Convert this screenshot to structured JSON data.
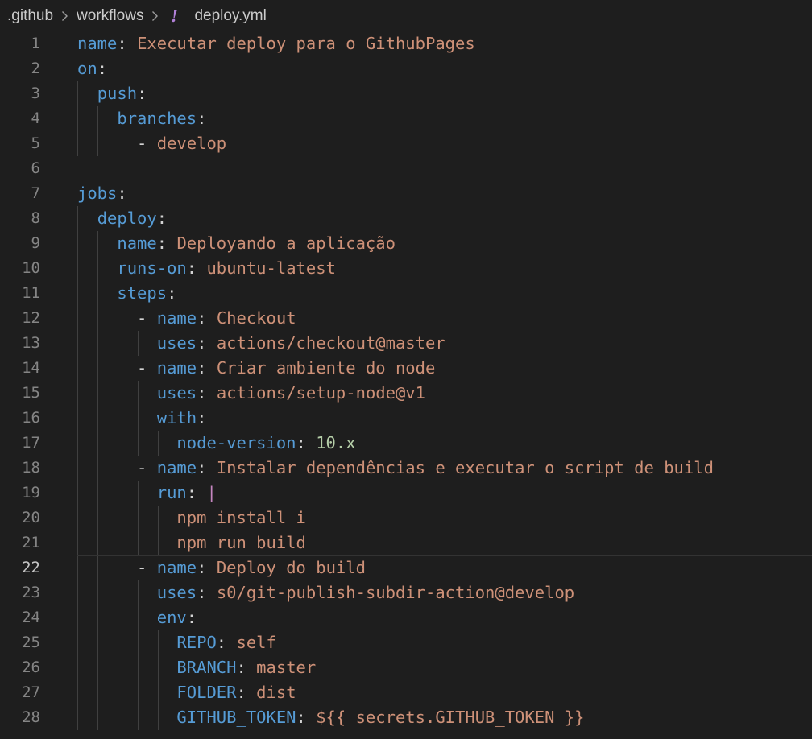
{
  "breadcrumb": {
    "folder1": ".github",
    "folder2": "workflows",
    "file_icon": "!",
    "file": "deploy.yml"
  },
  "editor": {
    "active_line": 22,
    "lines": [
      {
        "n": "1",
        "code": [
          {
            "t": "name",
            "c": "k"
          },
          {
            "t": ": ",
            "c": "p"
          },
          {
            "t": "Executar deploy para o GithubPages",
            "c": "s"
          }
        ]
      },
      {
        "n": "2",
        "code": [
          {
            "t": "on",
            "c": "k"
          },
          {
            "t": ":",
            "c": "p"
          }
        ]
      },
      {
        "n": "3",
        "code": [
          {
            "t": "  ",
            "c": "p"
          },
          {
            "t": "push",
            "c": "k"
          },
          {
            "t": ":",
            "c": "p"
          }
        ]
      },
      {
        "n": "4",
        "code": [
          {
            "t": "    ",
            "c": "p"
          },
          {
            "t": "branches",
            "c": "k"
          },
          {
            "t": ":",
            "c": "p"
          }
        ]
      },
      {
        "n": "5",
        "code": [
          {
            "t": "      - ",
            "c": "p"
          },
          {
            "t": "develop",
            "c": "s"
          }
        ]
      },
      {
        "n": "6",
        "code": []
      },
      {
        "n": "7",
        "code": [
          {
            "t": "jobs",
            "c": "k"
          },
          {
            "t": ":",
            "c": "p"
          }
        ]
      },
      {
        "n": "8",
        "code": [
          {
            "t": "  ",
            "c": "p"
          },
          {
            "t": "deploy",
            "c": "k"
          },
          {
            "t": ":",
            "c": "p"
          }
        ]
      },
      {
        "n": "9",
        "code": [
          {
            "t": "    ",
            "c": "p"
          },
          {
            "t": "name",
            "c": "k"
          },
          {
            "t": ": ",
            "c": "p"
          },
          {
            "t": "Deployando a aplicação",
            "c": "s"
          }
        ]
      },
      {
        "n": "10",
        "code": [
          {
            "t": "    ",
            "c": "p"
          },
          {
            "t": "runs-on",
            "c": "k"
          },
          {
            "t": ": ",
            "c": "p"
          },
          {
            "t": "ubuntu-latest",
            "c": "s"
          }
        ]
      },
      {
        "n": "11",
        "code": [
          {
            "t": "    ",
            "c": "p"
          },
          {
            "t": "steps",
            "c": "k"
          },
          {
            "t": ":",
            "c": "p"
          }
        ]
      },
      {
        "n": "12",
        "code": [
          {
            "t": "      - ",
            "c": "p"
          },
          {
            "t": "name",
            "c": "k"
          },
          {
            "t": ": ",
            "c": "p"
          },
          {
            "t": "Checkout",
            "c": "s"
          }
        ]
      },
      {
        "n": "13",
        "code": [
          {
            "t": "        ",
            "c": "p"
          },
          {
            "t": "uses",
            "c": "k"
          },
          {
            "t": ": ",
            "c": "p"
          },
          {
            "t": "actions/checkout@master",
            "c": "s"
          }
        ]
      },
      {
        "n": "14",
        "code": [
          {
            "t": "      - ",
            "c": "p"
          },
          {
            "t": "name",
            "c": "k"
          },
          {
            "t": ": ",
            "c": "p"
          },
          {
            "t": "Criar ambiente do node",
            "c": "s"
          }
        ]
      },
      {
        "n": "15",
        "code": [
          {
            "t": "        ",
            "c": "p"
          },
          {
            "t": "uses",
            "c": "k"
          },
          {
            "t": ": ",
            "c": "p"
          },
          {
            "t": "actions/setup-node@v1",
            "c": "s"
          }
        ]
      },
      {
        "n": "16",
        "code": [
          {
            "t": "        ",
            "c": "p"
          },
          {
            "t": "with",
            "c": "k"
          },
          {
            "t": ":",
            "c": "p"
          }
        ]
      },
      {
        "n": "17",
        "code": [
          {
            "t": "          ",
            "c": "p"
          },
          {
            "t": "node-version",
            "c": "k"
          },
          {
            "t": ": ",
            "c": "p"
          },
          {
            "t": "10.x",
            "c": "n"
          }
        ]
      },
      {
        "n": "18",
        "code": [
          {
            "t": "      - ",
            "c": "p"
          },
          {
            "t": "name",
            "c": "k"
          },
          {
            "t": ": ",
            "c": "p"
          },
          {
            "t": "Instalar dependências e executar o script de build",
            "c": "s"
          }
        ]
      },
      {
        "n": "19",
        "code": [
          {
            "t": "        ",
            "c": "p"
          },
          {
            "t": "run",
            "c": "k"
          },
          {
            "t": ": ",
            "c": "p"
          },
          {
            "t": "|",
            "c": "pipe"
          }
        ]
      },
      {
        "n": "20",
        "code": [
          {
            "t": "          ",
            "c": "p"
          },
          {
            "t": "npm install i",
            "c": "s"
          }
        ]
      },
      {
        "n": "21",
        "code": [
          {
            "t": "          ",
            "c": "p"
          },
          {
            "t": "npm run build",
            "c": "s"
          }
        ]
      },
      {
        "n": "22",
        "code": [
          {
            "t": "      - ",
            "c": "p"
          },
          {
            "t": "name",
            "c": "k"
          },
          {
            "t": ": ",
            "c": "p"
          },
          {
            "t": "Deploy do build",
            "c": "s"
          }
        ]
      },
      {
        "n": "23",
        "code": [
          {
            "t": "        ",
            "c": "p"
          },
          {
            "t": "uses",
            "c": "k"
          },
          {
            "t": ": ",
            "c": "p"
          },
          {
            "t": "s0/git-publish-subdir-action@develop",
            "c": "s"
          }
        ]
      },
      {
        "n": "24",
        "code": [
          {
            "t": "        ",
            "c": "p"
          },
          {
            "t": "env",
            "c": "k"
          },
          {
            "t": ":",
            "c": "p"
          }
        ]
      },
      {
        "n": "25",
        "code": [
          {
            "t": "          ",
            "c": "p"
          },
          {
            "t": "REPO",
            "c": "k"
          },
          {
            "t": ": ",
            "c": "p"
          },
          {
            "t": "self",
            "c": "s"
          }
        ]
      },
      {
        "n": "26",
        "code": [
          {
            "t": "          ",
            "c": "p"
          },
          {
            "t": "BRANCH",
            "c": "k"
          },
          {
            "t": ": ",
            "c": "p"
          },
          {
            "t": "master",
            "c": "s"
          }
        ]
      },
      {
        "n": "27",
        "code": [
          {
            "t": "          ",
            "c": "p"
          },
          {
            "t": "FOLDER",
            "c": "k"
          },
          {
            "t": ": ",
            "c": "p"
          },
          {
            "t": "dist",
            "c": "s"
          }
        ]
      },
      {
        "n": "28",
        "code": [
          {
            "t": "          ",
            "c": "p"
          },
          {
            "t": "GITHUB_TOKEN",
            "c": "k"
          },
          {
            "t": ": ",
            "c": "p"
          },
          {
            "t": "${{ secrets.GITHUB_TOKEN }}",
            "c": "s"
          }
        ]
      }
    ]
  }
}
